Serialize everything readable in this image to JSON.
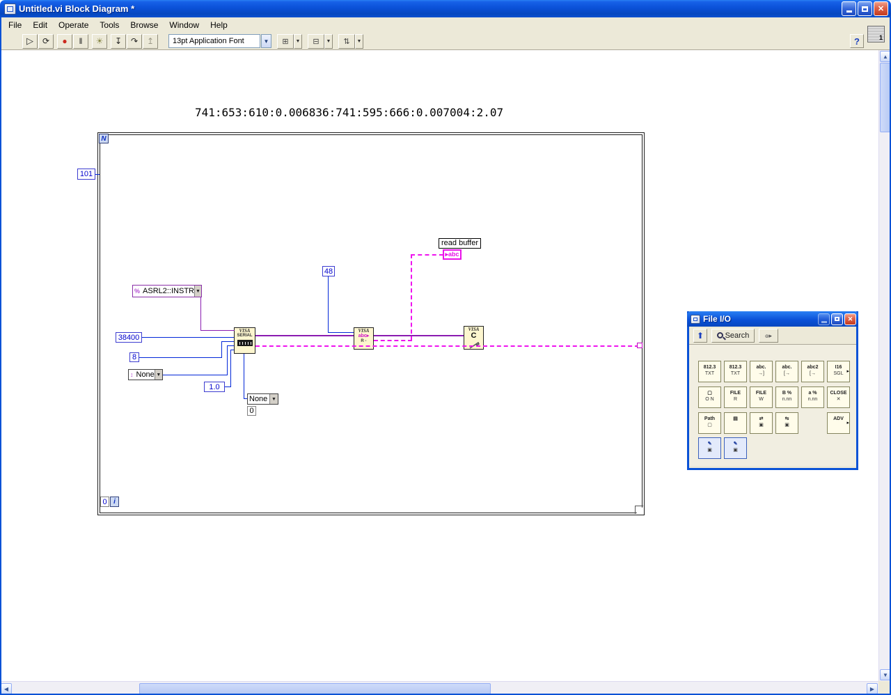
{
  "window": {
    "title": "Untitled.vi Block Diagram *",
    "buttons": {
      "close": "✕"
    }
  },
  "menu": {
    "items": [
      "File",
      "Edit",
      "Operate",
      "Tools",
      "Browse",
      "Window",
      "Help"
    ]
  },
  "toolbar": {
    "font_selector": "13pt Application Font",
    "help": "?",
    "vi_badge": "1",
    "buttons": {
      "run": "▷",
      "run_continuous": "⟳",
      "abort": "●",
      "pause": "‖",
      "highlight": "☀",
      "step_into": "↧",
      "step_over": "↷",
      "step_out": "↥",
      "align": "⊞",
      "distribute": "⊟",
      "reorder": "⇅",
      "arrow": "▼"
    }
  },
  "diagram": {
    "free_label": "741:653:610:0.006836:741:595:666:0.007004:2.07",
    "loop": {
      "n": "N",
      "count": "101",
      "index": "0",
      "iter": "i"
    },
    "visa_resource": {
      "glyph": "%",
      "value": "ASRL2::INSTR"
    },
    "baud": "38400",
    "data_bits": "8",
    "parity": "None",
    "stop_bits": "1.0",
    "flow_control": "None",
    "flow_const": "0",
    "byte_count": "48",
    "serial_node": {
      "l1": "VISA",
      "l2": "SERIAL"
    },
    "read_node": {
      "l1": "VISA",
      "l2": "abc▸",
      "l3": "R ▫"
    },
    "close_node": {
      "l1": "VISA",
      "l2": "C"
    },
    "indicator": {
      "label": "read buffer",
      "terminal": "▸abc"
    }
  },
  "palette": {
    "title": "File I/O",
    "search": "Search",
    "up": "⬆",
    "icons": [
      {
        "l1": "812.3",
        "l2": "TXT"
      },
      {
        "l1": "812.3",
        "l2": "TXT"
      },
      {
        "l1": "abc.",
        "l2": "→]"
      },
      {
        "l1": "abc.",
        "l2": "[→"
      },
      {
        "l1": "abc2",
        "l2": "[→"
      },
      {
        "l1": "I16",
        "l2": "SGL"
      },
      {
        "l1": "▢",
        "l2": "O N"
      },
      {
        "l1": "FILE",
        "l2": "R"
      },
      {
        "l1": "FILE",
        "l2": "W"
      },
      {
        "l1": "B %",
        "l2": "n.nn"
      },
      {
        "l1": "a %",
        "l2": "n.nn"
      },
      {
        "l1": "CLOSE",
        "l2": "✕"
      },
      {
        "l1": "Path",
        "l2": "▢"
      },
      {
        "l1": "▤",
        "l2": ""
      },
      {
        "l1": "⇄",
        "l2": "▣"
      },
      {
        "l1": "⇆",
        "l2": "▣"
      },
      {
        "l1": "ADV",
        "l2": ""
      },
      {
        "l1": "✎",
        "l2": "▣"
      },
      {
        "l1": "✎",
        "l2": "▣"
      }
    ]
  },
  "colors": {
    "titlebar": "#0b51d8",
    "toolbar_bg": "#ece9d8",
    "wire_numeric": "#0026d8",
    "wire_visa": "#8a1bb0",
    "wire_string": "#ef13ef"
  }
}
